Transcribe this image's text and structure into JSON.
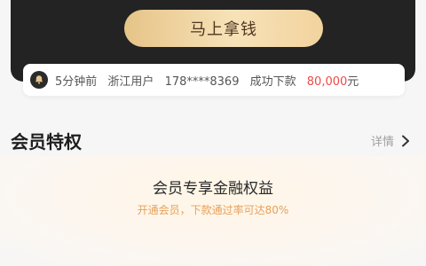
{
  "hero": {
    "cta_label": "马上拿钱"
  },
  "notice": {
    "time": "5分钟前",
    "region_user": "浙江用户",
    "phone": "178****8369",
    "action": "成功下款",
    "amount": "80,000",
    "unit": "元",
    "icon": "bell-icon"
  },
  "section": {
    "title": "会员特权",
    "details_label": "详情",
    "details_icon": "chevron-right-icon"
  },
  "benefit": {
    "title": "会员专享金融权益",
    "subtitle": "开通会员，下款通过率可达80%"
  },
  "colors": {
    "hero_bg": "#232323",
    "cta_gold": "#f0d39f",
    "highlight_red": "#ef4a47",
    "subtitle_orange": "#e7a05a"
  }
}
